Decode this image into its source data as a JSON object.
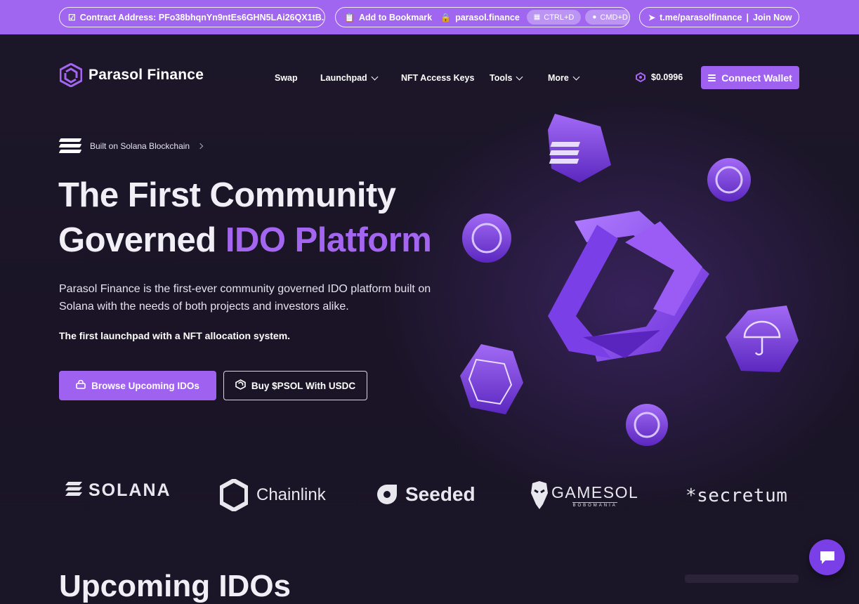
{
  "topbar": {
    "contract": "Contract Address: PFo38bhqnYn9ntEs6GHN5LAi26QX1tB...",
    "bookmark": "Add to Bookmark",
    "domain": "parasol.finance",
    "ctrl": "CTRL+D",
    "cmd": "CMD+D",
    "telegram": "t.me/parasolfinance",
    "join": "Join Now"
  },
  "nav": {
    "brand": "Parasol Finance",
    "items": [
      {
        "label": "Swap"
      },
      {
        "label": "Launchpad"
      },
      {
        "label": "NFT Access Keys"
      },
      {
        "label": "Tools"
      },
      {
        "label": "More"
      }
    ],
    "price": "$0.0996",
    "connect": "Connect Wallet"
  },
  "hero": {
    "built": "Built on Solana Blockchain",
    "title_line1": "The First Community",
    "title_line2_plain": "Governed ",
    "title_line2_accent": "IDO Platform",
    "description": "Parasol Finance is the first-ever community governed IDO platform built on Solana with the needs of both projects and investors alike.",
    "tagline": "The first launchpad with a NFT allocation system.",
    "primary_button": "Browse Upcoming IDOs",
    "secondary_button": "Buy $PSOL With USDC"
  },
  "partners": [
    {
      "name": "SOLANA"
    },
    {
      "name": "Chainlink"
    },
    {
      "name": "Seeded"
    },
    {
      "name": "GAMESOL",
      "sub": "BOBOMANIA"
    },
    {
      "name": "*secretum"
    }
  ],
  "section_peek": "Upcoming IDOs",
  "colors": {
    "accent": "#a066ef",
    "background": "#1b1528"
  }
}
